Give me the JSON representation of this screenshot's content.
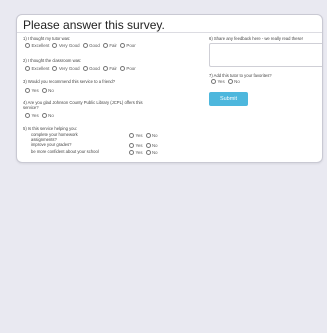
{
  "survey": {
    "title": "Please answer this survey.",
    "q1": {
      "label": "1) I thought my tutor was:",
      "options": [
        "Excellent",
        "Very Good",
        "Good",
        "Fair",
        "Poor"
      ]
    },
    "q2": {
      "label": "2) I thought the classroom was:",
      "options": [
        "Excellent",
        "Very Good",
        "Good",
        "Fair",
        "Poor"
      ]
    },
    "q3": {
      "label": "3) Would you recommend this service to a friend?",
      "options": [
        "Yes",
        "No"
      ]
    },
    "q4": {
      "label_line1": "4) Are you glad Johnson County Public Library (JCPL) offers this",
      "label_line2": "service?",
      "options": [
        "Yes",
        "No"
      ]
    },
    "q5": {
      "label": "5) Is this service helping you:",
      "rows": [
        {
          "line1": "complete your homework",
          "line2": "assignments?",
          "options": [
            "Yes",
            "No"
          ]
        },
        {
          "line1": "improve your grades?",
          "line2": "",
          "options": [
            "Yes",
            "No"
          ]
        },
        {
          "line1": "be more confident about your school",
          "line2": "",
          "options": [
            "Yes",
            "No"
          ]
        }
      ]
    },
    "q6": {
      "label": "6) Share any feedback here - we really read these!"
    },
    "q7": {
      "label": "7) Add this tutor to your favorites?",
      "options": [
        "Yes",
        "No"
      ]
    },
    "submit_label": "Submit"
  }
}
